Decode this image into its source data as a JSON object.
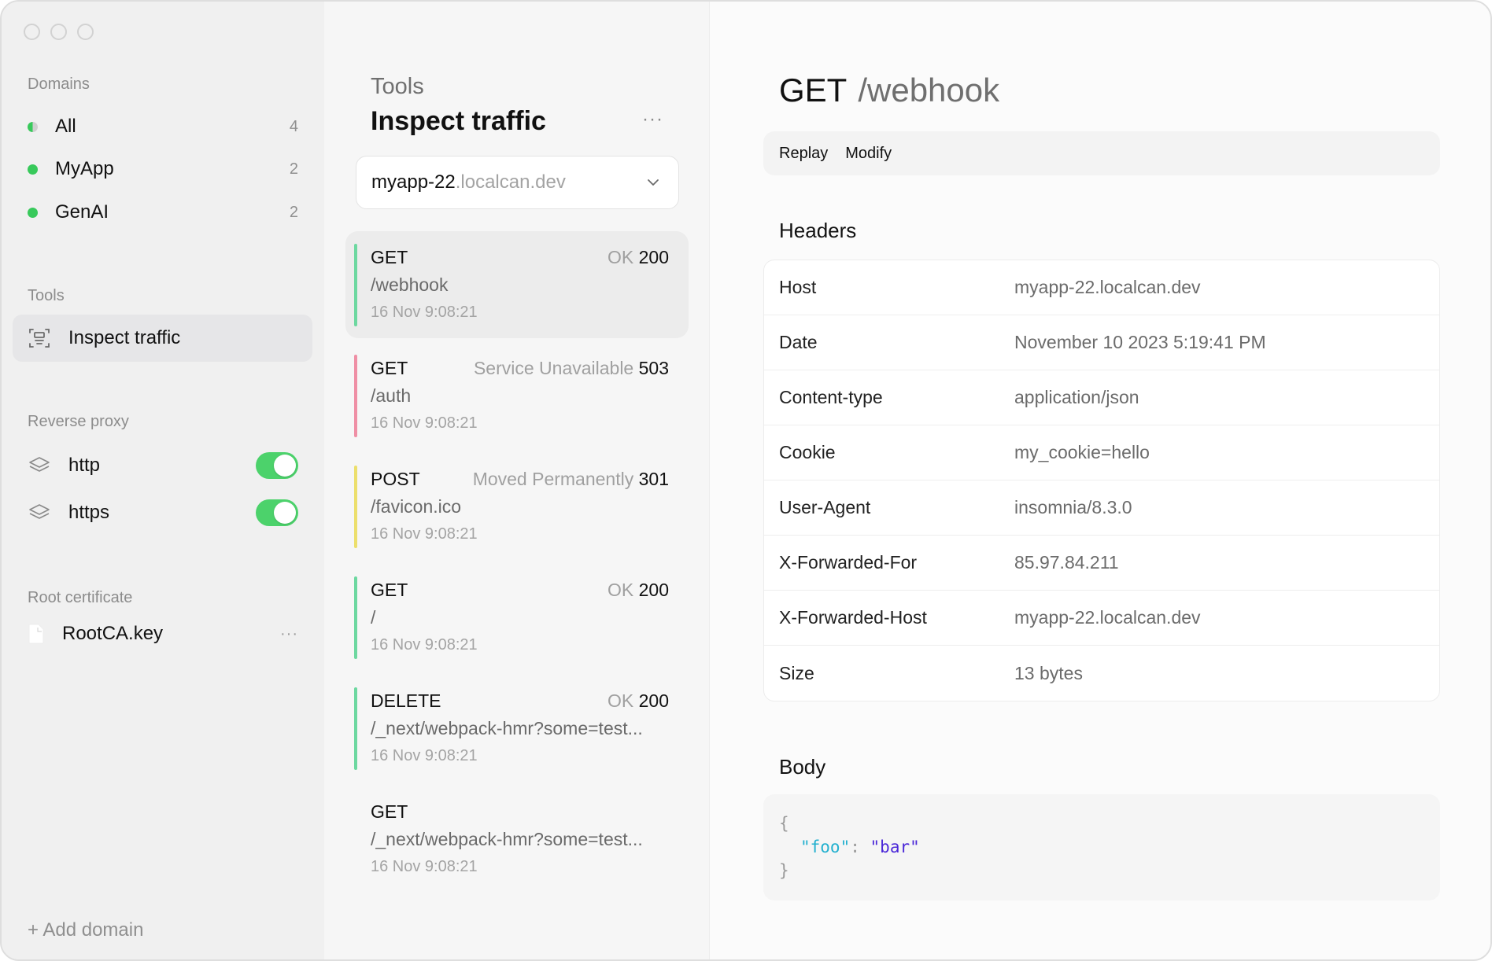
{
  "sidebar": {
    "domains_label": "Domains",
    "domains": [
      {
        "label": "All",
        "count": "4",
        "dot": "half"
      },
      {
        "label": "MyApp",
        "count": "2",
        "dot": "green"
      },
      {
        "label": "GenAI",
        "count": "2",
        "dot": "green"
      }
    ],
    "tools_label": "Tools",
    "tools": [
      {
        "label": "Inspect traffic",
        "icon": "inspect-icon",
        "selected": true
      }
    ],
    "reverse_proxy_label": "Reverse proxy",
    "proxies": [
      {
        "label": "http",
        "icon": "layers-icon",
        "enabled": true
      },
      {
        "label": "https",
        "icon": "layers-icon",
        "enabled": true
      }
    ],
    "root_cert_label": "Root certificate",
    "root_cert": {
      "label": "RootCA.key",
      "icon": "document-icon",
      "more": "···"
    },
    "add_domain": "+ Add domain"
  },
  "middle": {
    "eyebrow": "Tools",
    "title": "Inspect traffic",
    "more": "···",
    "domain_select": {
      "subdomain": "myapp-22",
      "base": ".localcan.dev"
    },
    "traffic": [
      {
        "method": "GET",
        "status_text": "OK",
        "status_code": "200",
        "path": "/webhook",
        "time": "16 Nov 9:08:21",
        "bar_color": "#6dd8a0",
        "selected": true
      },
      {
        "method": "GET",
        "status_text": "Service Unavailable",
        "status_code": "503",
        "path": "/auth",
        "time": "16 Nov 9:08:21",
        "bar_color": "#ef8fa5",
        "selected": false
      },
      {
        "method": "POST",
        "status_text": "Moved Permanently",
        "status_code": "301",
        "path": "/favicon.ico",
        "time": "16 Nov 9:08:21",
        "bar_color": "#ecdf6c",
        "selected": false
      },
      {
        "method": "GET",
        "status_text": "OK",
        "status_code": "200",
        "path": "/",
        "time": "16 Nov 9:08:21",
        "bar_color": "#6dd8a0",
        "selected": false
      },
      {
        "method": "DELETE",
        "status_text": "OK",
        "status_code": "200",
        "path": "/_next/webpack-hmr?some=test...",
        "time": "16 Nov 9:08:21",
        "bar_color": "#6dd8a0",
        "selected": false
      },
      {
        "method": "GET",
        "status_text": "",
        "status_code": "",
        "path": "/_next/webpack-hmr?some=test...",
        "time": "16 Nov 9:08:21",
        "bar_color": "",
        "selected": false
      }
    ]
  },
  "detail": {
    "method": "GET",
    "path": "/webhook",
    "actions": {
      "replay": "Replay",
      "modify": "Modify"
    },
    "headers_title": "Headers",
    "headers": [
      {
        "key": "Host",
        "value": "myapp-22.localcan.dev"
      },
      {
        "key": "Date",
        "value": "November 10 2023 5:19:41 PM"
      },
      {
        "key": "Content-type",
        "value": "application/json"
      },
      {
        "key": "Cookie",
        "value": "my_cookie=hello"
      },
      {
        "key": "User-Agent",
        "value": "insomnia/8.3.0"
      },
      {
        "key": "X-Forwarded-For",
        "value": "85.97.84.211"
      },
      {
        "key": "X-Forwarded-Host",
        "value": "myapp-22.localcan.dev"
      },
      {
        "key": "Size",
        "value": "13 bytes"
      }
    ],
    "body_title": "Body",
    "body": {
      "open": "{",
      "key": "\"foo\"",
      "colon": ":",
      "value": "\"bar\"",
      "close": "}"
    }
  },
  "colors": {
    "accent_green": "#4cd26b",
    "status_ok": "#6dd8a0",
    "status_error": "#ef8fa5",
    "status_redirect": "#ecdf6c",
    "json_key": "#22b0cf",
    "json_value": "#4b28d8"
  }
}
